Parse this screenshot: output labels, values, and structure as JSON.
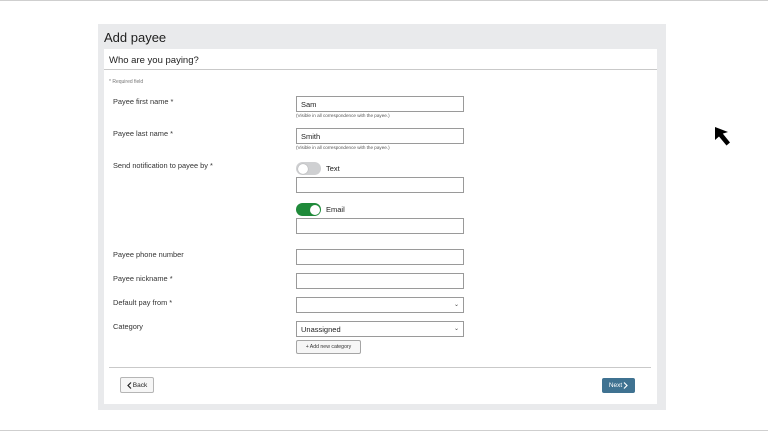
{
  "page": {
    "title": "Add payee"
  },
  "card": {
    "title": "Who are you paying?",
    "required_note": "* Required field"
  },
  "fields": {
    "first_name": {
      "label": "Payee first name *",
      "value": "Sam",
      "hint": "(Visible in all correspondence with the payee.)"
    },
    "last_name": {
      "label": "Payee last name *",
      "value": "Smith",
      "hint": "(Visible in all correspondence with the payee.)"
    },
    "notification": {
      "label": "Send notification to payee by *",
      "text_option": {
        "label": "Text",
        "enabled": false,
        "value": ""
      },
      "email_option": {
        "label": "Email",
        "enabled": true,
        "value": ""
      }
    },
    "phone": {
      "label": "Payee phone number",
      "value": ""
    },
    "nickname": {
      "label": "Payee nickname *",
      "value": ""
    },
    "pay_from": {
      "label": "Default pay from *",
      "value": ""
    },
    "category": {
      "label": "Category",
      "value": "Unassigned",
      "add_button": "Add new category"
    }
  },
  "buttons": {
    "back": "Back",
    "next": "Next"
  },
  "colors": {
    "primary": "#3f7291",
    "toggle_on": "#1f8a3a",
    "toggle_off": "#cfd0d2",
    "outer_bg": "#e9eaec"
  },
  "icons": {
    "back": "chevron-left-icon",
    "next": "chevron-right-icon",
    "select": "chevron-down-icon",
    "add": "plus-icon",
    "cursor": "mouse-pointer-icon"
  }
}
